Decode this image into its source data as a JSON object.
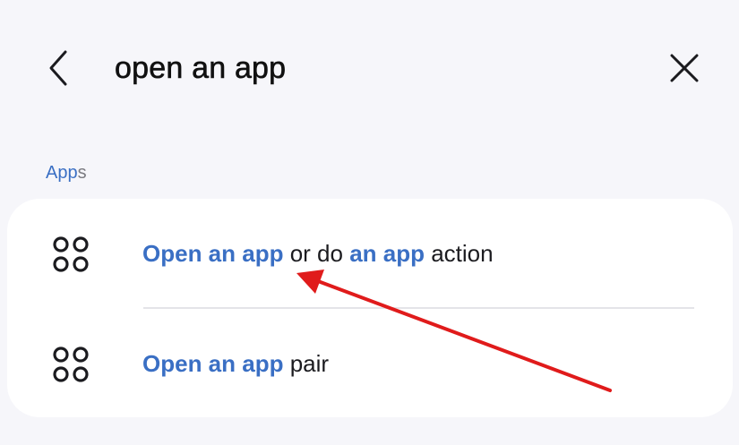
{
  "header": {
    "back_icon": "chevron-left-icon",
    "search_query": "open an app",
    "close_icon": "close-icon"
  },
  "results": {
    "section_label_match": "App",
    "section_label_rest": "s",
    "items": [
      {
        "icon": "app-grid-icon",
        "parts": [
          "Open an app",
          " or do ",
          "an app",
          " action"
        ]
      },
      {
        "icon": "app-grid-icon",
        "parts": [
          "Open an app",
          " pair"
        ]
      }
    ]
  },
  "colors": {
    "background": "#f6f6fa",
    "card": "#ffffff",
    "highlight": "#3a6fc4",
    "annotation_arrow": "#e01b1b"
  }
}
